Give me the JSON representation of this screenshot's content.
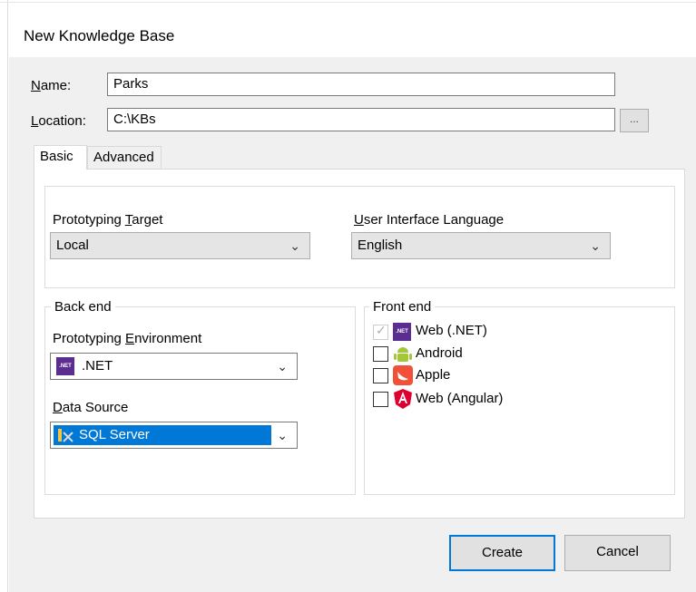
{
  "dialog": {
    "title": "New Knowledge Base"
  },
  "name_field": {
    "label": "Name:",
    "value": "Parks"
  },
  "location_field": {
    "label": "Location:",
    "value": "C:\\KBs",
    "browse_label": "..."
  },
  "tabs": [
    {
      "label": "Basic",
      "active": true
    },
    {
      "label": "Advanced",
      "active": false
    }
  ],
  "prototyping_target": {
    "label": "Prototyping Target",
    "value": "Local"
  },
  "ui_language": {
    "label": "User Interface Language",
    "value": "English"
  },
  "back_end": {
    "group_label": "Back end",
    "environment": {
      "label": "Prototyping Environment",
      "value": ".NET",
      "icon": "dotnet-icon"
    },
    "data_source": {
      "label": "Data Source",
      "value": "SQL Server",
      "icon": "sql-server-icon"
    }
  },
  "front_end": {
    "group_label": "Front end",
    "items": [
      {
        "label": "Web (.NET)",
        "checked": true,
        "disabled": true,
        "icon": "dotnet-icon",
        "icon_text": ".NET"
      },
      {
        "label": "Android",
        "checked": false,
        "icon": "android-icon"
      },
      {
        "label": "Apple",
        "checked": false,
        "icon": "swift-icon"
      },
      {
        "label": "Web (Angular)",
        "checked": false,
        "icon": "angular-icon"
      }
    ]
  },
  "buttons": {
    "create": "Create",
    "cancel": "Cancel"
  },
  "colors": {
    "accent": "#0078d7",
    "dialog_bg": "#f0f0f0",
    "dotnet": "#5c2d91",
    "android": "#a4c639",
    "swift": "#f05138",
    "angular": "#dd0031"
  }
}
